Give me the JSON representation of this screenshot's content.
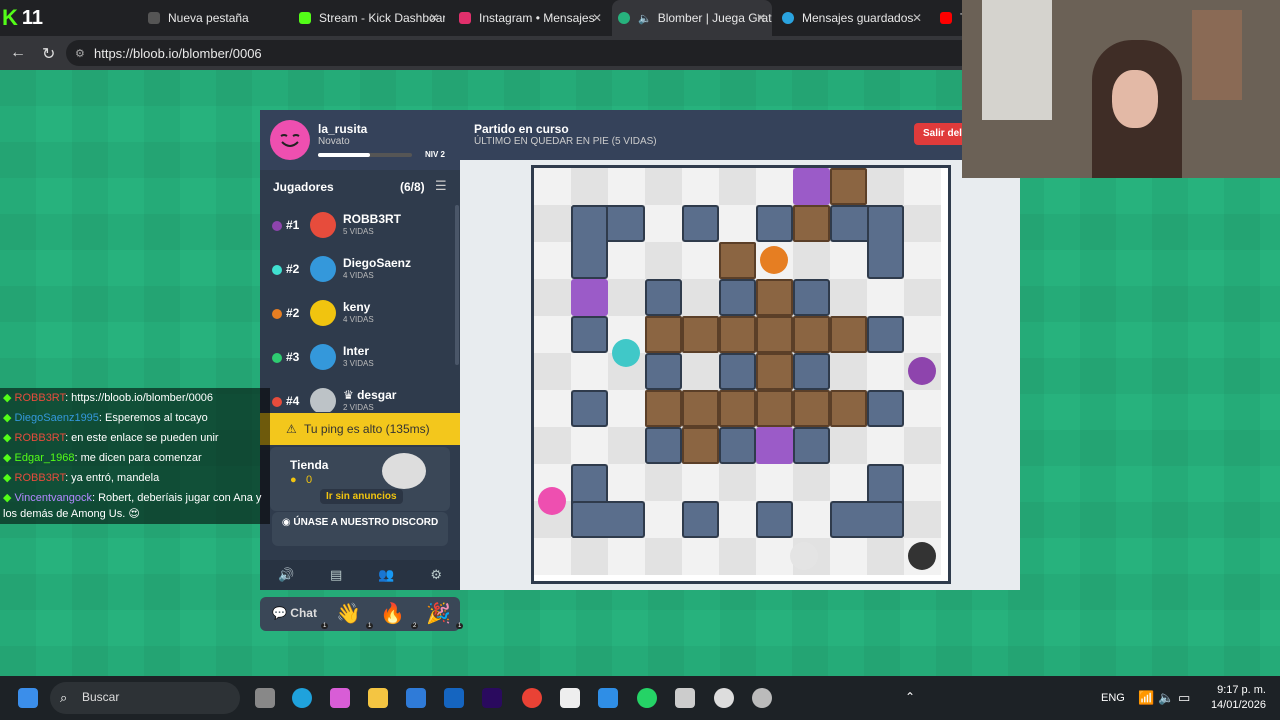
{
  "tabs": [
    {
      "label": "",
      "icon": "kick-icon",
      "color": "#53fc18"
    },
    {
      "label": "Nueva pestaña",
      "icon": "newtab-icon",
      "color": "#7b68ee"
    },
    {
      "label": "Stream - Kick Dashboard",
      "icon": "kick-icon",
      "color": "#53fc18"
    },
    {
      "label": "Instagram • Mensajes",
      "icon": "instagram-icon",
      "color": "#e1306c"
    },
    {
      "label": "Blomber | Juega Gratis",
      "icon": "bloob-icon",
      "color": "#27b27d"
    },
    {
      "label": "Mensajes guardados",
      "icon": "telegram-icon",
      "color": "#2aa3df"
    },
    {
      "label": "T",
      "icon": "youtube-icon",
      "color": "#ff0000"
    }
  ],
  "browser": {
    "url": "https://bloob.io/blomber/0006"
  },
  "profile": {
    "name": "la_rusita",
    "rank": "Novato",
    "level": "NIV 2",
    "xp_fraction": 0.55
  },
  "players": {
    "title": "Jugadores",
    "count": "(6/8)",
    "list": [
      {
        "rank": "#1",
        "name": "ROBB3RT",
        "lives": "5 VIDAS",
        "color": "#8e44ad",
        "avatar": "#e74c3c"
      },
      {
        "rank": "#2",
        "name": "DiegoSaenz",
        "lives": "4 VIDAS",
        "color": "#40e0d0",
        "avatar": "#3498db"
      },
      {
        "rank": "#2",
        "name": "keny",
        "lives": "4 VIDAS",
        "color": "#e67e22",
        "avatar": "#f1c40f"
      },
      {
        "rank": "#3",
        "name": "Inter",
        "lives": "3 VIDAS",
        "color": "#2ecc71",
        "avatar": "#3498db"
      },
      {
        "rank": "#4",
        "name": "♛ desgar",
        "lives": "2 VIDAS",
        "color": "#e74c3c",
        "avatar": "#bdc3c7"
      }
    ]
  },
  "ping_warning": "Tu ping es alto (135ms)",
  "shop": {
    "title": "Tienda",
    "coins": "0",
    "no_ads": "Ir sin anuncios"
  },
  "discord": "ÚNASE A NUESTRO DISCORD",
  "chat": {
    "label": "Chat",
    "reactions": [
      {
        "emoji": "👋",
        "count": "1"
      },
      {
        "emoji": "🔥",
        "count": "2"
      },
      {
        "emoji": "🎉",
        "count": "1"
      }
    ],
    "reaction_first_count": "1"
  },
  "game": {
    "title": "Partido en curso",
    "subtitle": "ÚLTIMO EN QUEDAR EN PIE (5 VIDAS)",
    "leave": "Salir del"
  },
  "stream_chat": [
    {
      "user": "ROBB3RT",
      "text": ": https://bloob.io/blomber/0006",
      "color": "#e74c3c"
    },
    {
      "user": "DiegoSaenz1995",
      "text": ": Esperemos al tocayo",
      "color": "#3498db"
    },
    {
      "user": "ROBB3RT",
      "text": ": en este enlace se pueden unir",
      "color": "#e74c3c"
    },
    {
      "user": "Edgar_1968",
      "text": ": me dicen para comenzar",
      "color": "#53fc18"
    },
    {
      "user": "ROBB3RT",
      "text": ": ya entró, mandela",
      "color": "#e74c3c"
    },
    {
      "user": "Vincentvangock",
      "text": ": Robert, deberíais jugar con Ana y los demás de Among Us. 😍",
      "color": "#b388ff"
    }
  ],
  "taskbar": {
    "search": "Buscar",
    "lang": "ENG",
    "time": "9:17 p. m.",
    "date": "14/01/2026"
  }
}
